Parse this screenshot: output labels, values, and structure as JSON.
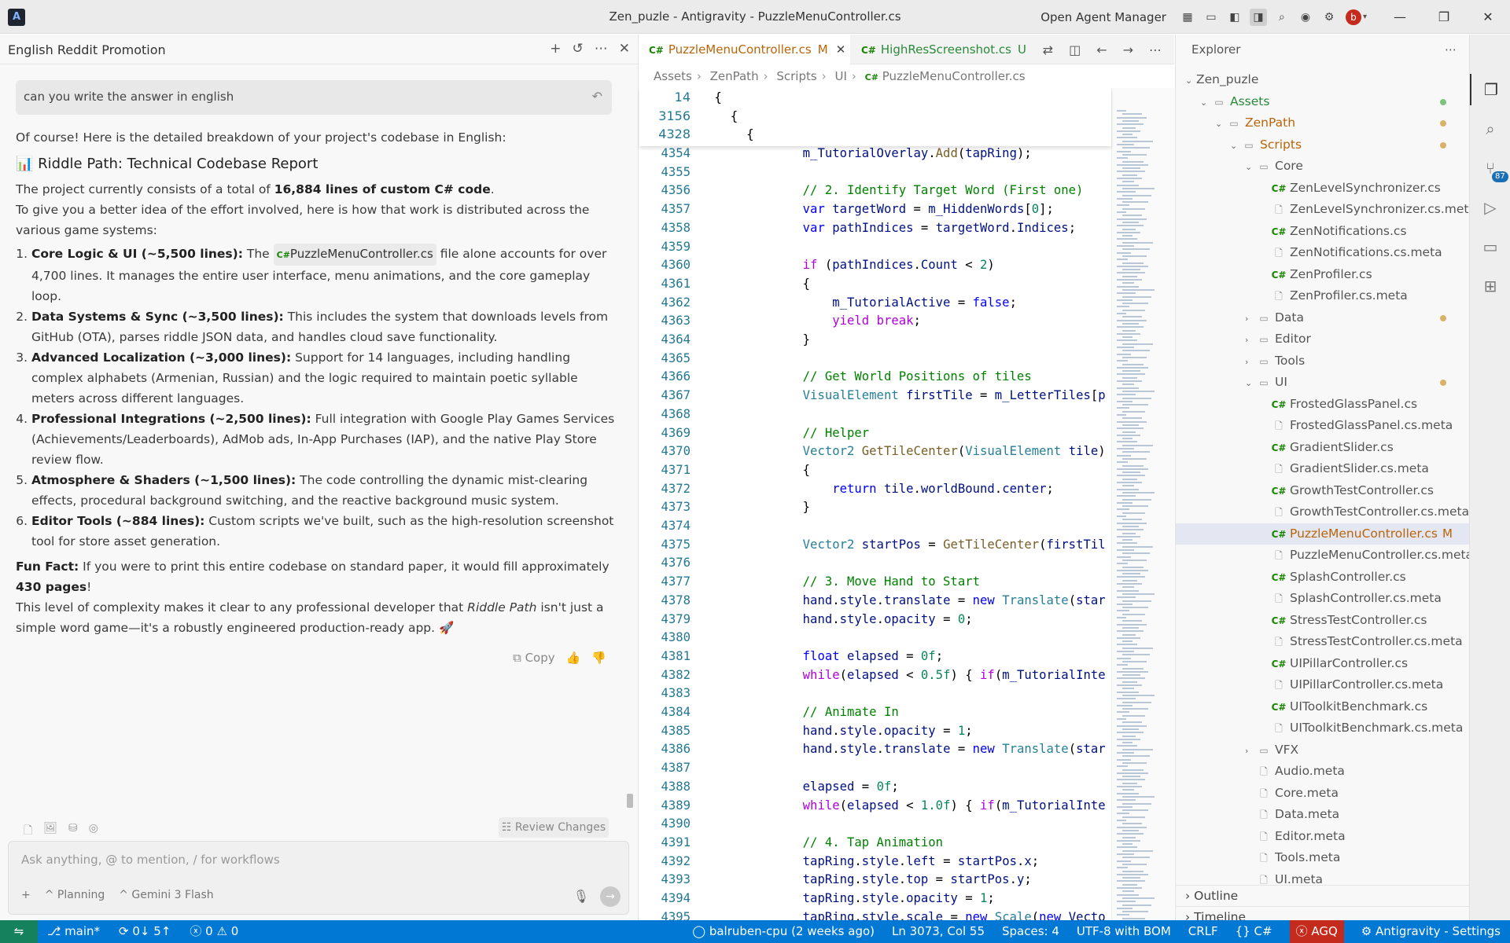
{
  "window": {
    "title": "Zen_puzle - Antigravity - PuzzleMenuController.cs",
    "open_agent_manager": "Open Agent Manager",
    "avatar_letter": "b"
  },
  "chat": {
    "title": "English Reddit Promotion",
    "user_message": "can you write the answer in english",
    "intro": "Of course! Here is the detailed breakdown of your project's codebase in English:",
    "heading_icon": "📊",
    "heading": "Riddle Path: Technical Codebase Report",
    "para1_prefix": "The project currently consists of a total of ",
    "para1_bold": "16,884 lines of custom C# code",
    "para1_suffix": ".",
    "para2": "To give you a better idea of the effort involved, here is how that work is distributed across the various game systems:",
    "items": [
      {
        "title": "Core Logic & UI (~5,500 lines):",
        "pre": " The ",
        "chip": "PuzzleMenuController.cs",
        "text": " file alone accounts for over 4,700 lines. It manages the entire user interface, menu animations, and the core gameplay loop."
      },
      {
        "title": "Data Systems & Sync (~3,500 lines):",
        "text": " This includes the system that downloads levels from GitHub (OTA), parses riddle JSON data, and handles cloud save functionality."
      },
      {
        "title": "Advanced Localization (~3,000 lines):",
        "text": " Support for 14 languages, including handling complex alphabets (Armenian, Russian) and the logic required to maintain poetic syllable meters across different languages."
      },
      {
        "title": "Professional Integrations (~2,500 lines):",
        "text": " Full integration with Google Play Games Services (Achievements/Leaderboards), AdMob ads, In-App Purchases (IAP), and the native Play Store review flow."
      },
      {
        "title": "Atmosphere & Shaders (~1,500 lines):",
        "text": " The code controlling the dynamic mist-clearing effects, procedural background switching, and the reactive background music system."
      },
      {
        "title": "Editor Tools (~884 lines):",
        "text": " Custom scripts we've built, such as the high-resolution screenshot tool for store asset generation."
      }
    ],
    "fun_label": "Fun Fact:",
    "fun_text": " If you were to print this entire codebase on standard paper, it would fill approximately ",
    "fun_bold": "430 pages",
    "fun_end": "!",
    "closing_pre": "This level of complexity makes it clear to any professional developer that ",
    "closing_em": "Riddle Path",
    "closing_post": " isn't just a simple word game—it's a robustly engineered production-ready app. 🚀",
    "copy_label": "Copy",
    "review_label": "Review Changes",
    "input_placeholder": "Ask anything, @ to mention, / for workflows",
    "mode_label": "Planning",
    "model_label": "Gemini 3 Flash"
  },
  "editor": {
    "tabs": [
      {
        "label": "PuzzleMenuController.cs",
        "mark": "M"
      },
      {
        "label": "HighResScreenshot.cs",
        "mark": "U"
      }
    ],
    "breadcrumbs": [
      "Assets",
      "ZenPath",
      "Scripts",
      "UI",
      "PuzzleMenuController.cs"
    ],
    "sticky": [
      {
        "ln": "14",
        "code": "{"
      },
      {
        "ln": "3156",
        "code": "    {"
      },
      {
        "ln": "4328",
        "code": "        {"
      }
    ],
    "lines": [
      {
        "ln": "4354",
        "code": "            m_TutorialOverlay.Add(tapRing);"
      },
      {
        "ln": "4355",
        "code": ""
      },
      {
        "ln": "4356",
        "code": "            // 2. Identify Target Word (First one)"
      },
      {
        "ln": "4357",
        "code": "            var targetWord = m_HiddenWords[0];"
      },
      {
        "ln": "4358",
        "code": "            var pathIndices = targetWord.Indices;"
      },
      {
        "ln": "4359",
        "code": ""
      },
      {
        "ln": "4360",
        "code": "            if (pathIndices.Count < 2)"
      },
      {
        "ln": "4361",
        "code": "            {"
      },
      {
        "ln": "4362",
        "code": "                m_TutorialActive = false;"
      },
      {
        "ln": "4363",
        "code": "                yield break;"
      },
      {
        "ln": "4364",
        "code": "            }"
      },
      {
        "ln": "4365",
        "code": ""
      },
      {
        "ln": "4366",
        "code": "            // Get World Positions of tiles"
      },
      {
        "ln": "4367",
        "code": "            VisualElement firstTile = m_LetterTiles[p"
      },
      {
        "ln": "4368",
        "code": ""
      },
      {
        "ln": "4369",
        "code": "            // Helper"
      },
      {
        "ln": "4370",
        "code": "            Vector2 GetTileCenter(VisualElement tile)"
      },
      {
        "ln": "4371",
        "code": "            {"
      },
      {
        "ln": "4372",
        "code": "                return tile.worldBound.center;"
      },
      {
        "ln": "4373",
        "code": "            }"
      },
      {
        "ln": "4374",
        "code": ""
      },
      {
        "ln": "4375",
        "code": "            Vector2 startPos = GetTileCenter(firstTil"
      },
      {
        "ln": "4376",
        "code": ""
      },
      {
        "ln": "4377",
        "code": "            // 3. Move Hand to Start"
      },
      {
        "ln": "4378",
        "code": "            hand.style.translate = new Translate(star"
      },
      {
        "ln": "4379",
        "code": "            hand.style.opacity = 0;"
      },
      {
        "ln": "4380",
        "code": ""
      },
      {
        "ln": "4381",
        "code": "            float elapsed = 0f;"
      },
      {
        "ln": "4382",
        "code": "            while(elapsed < 0.5f) { if(m_TutorialInte"
      },
      {
        "ln": "4383",
        "code": ""
      },
      {
        "ln": "4384",
        "code": "            // Animate In"
      },
      {
        "ln": "4385",
        "code": "            hand.style.opacity = 1;"
      },
      {
        "ln": "4386",
        "code": "            hand.style.translate = new Translate(star"
      },
      {
        "ln": "4387",
        "code": ""
      },
      {
        "ln": "4388",
        "code": "            elapsed = 0f;"
      },
      {
        "ln": "4389",
        "code": "            while(elapsed < 1.0f) { if(m_TutorialInte"
      },
      {
        "ln": "4390",
        "code": ""
      },
      {
        "ln": "4391",
        "code": "            // 4. Tap Animation"
      },
      {
        "ln": "4392",
        "code": "            tapRing.style.left = startPos.x;"
      },
      {
        "ln": "4393",
        "code": "            tapRing.style.top = startPos.y;"
      },
      {
        "ln": "4394",
        "code": "            tapRing.style.opacity = 1;"
      },
      {
        "ln": "4395",
        "code": "            tapRing.style.scale = new Scale(new Vecto"
      }
    ]
  },
  "explorer": {
    "title": "Explorer",
    "tree": [
      {
        "label": "Zen_puzle",
        "depth": 0,
        "kind": "root"
      },
      {
        "label": "Assets",
        "depth": 1,
        "kind": "folder-open",
        "color": "green",
        "dot": "green"
      },
      {
        "label": "ZenPath",
        "depth": 2,
        "kind": "folder-open",
        "color": "gold",
        "dot": "gold"
      },
      {
        "label": "Scripts",
        "depth": 3,
        "kind": "folder-open",
        "color": "gold",
        "dot": "gold"
      },
      {
        "label": "Core",
        "depth": 4,
        "kind": "folder-open"
      },
      {
        "label": "ZenLevelSynchronizer.cs",
        "depth": 5,
        "kind": "cs"
      },
      {
        "label": "ZenLevelSynchronizer.cs.meta",
        "depth": 5,
        "kind": "file"
      },
      {
        "label": "ZenNotifications.cs",
        "depth": 5,
        "kind": "cs"
      },
      {
        "label": "ZenNotifications.cs.meta",
        "depth": 5,
        "kind": "file"
      },
      {
        "label": "ZenProfiler.cs",
        "depth": 5,
        "kind": "cs"
      },
      {
        "label": "ZenProfiler.cs.meta",
        "depth": 5,
        "kind": "file"
      },
      {
        "label": "Data",
        "depth": 4,
        "kind": "folder",
        "dot": "gold"
      },
      {
        "label": "Editor",
        "depth": 4,
        "kind": "folder"
      },
      {
        "label": "Tools",
        "depth": 4,
        "kind": "folder"
      },
      {
        "label": "UI",
        "depth": 4,
        "kind": "folder-open",
        "dot": "gold"
      },
      {
        "label": "FrostedGlassPanel.cs",
        "depth": 5,
        "kind": "cs"
      },
      {
        "label": "FrostedGlassPanel.cs.meta",
        "depth": 5,
        "kind": "file"
      },
      {
        "label": "GradientSlider.cs",
        "depth": 5,
        "kind": "cs"
      },
      {
        "label": "GradientSlider.cs.meta",
        "depth": 5,
        "kind": "file"
      },
      {
        "label": "GrowthTestController.cs",
        "depth": 5,
        "kind": "cs"
      },
      {
        "label": "GrowthTestController.cs.meta",
        "depth": 5,
        "kind": "file"
      },
      {
        "label": "PuzzleMenuController.cs",
        "depth": 5,
        "kind": "cs",
        "selected": true,
        "mark": "M",
        "color": "gold"
      },
      {
        "label": "PuzzleMenuController.cs.meta",
        "depth": 5,
        "kind": "file"
      },
      {
        "label": "SplashController.cs",
        "depth": 5,
        "kind": "cs"
      },
      {
        "label": "SplashController.cs.meta",
        "depth": 5,
        "kind": "file"
      },
      {
        "label": "StressTestController.cs",
        "depth": 5,
        "kind": "cs"
      },
      {
        "label": "StressTestController.cs.meta",
        "depth": 5,
        "kind": "file"
      },
      {
        "label": "UIPillarController.cs",
        "depth": 5,
        "kind": "cs"
      },
      {
        "label": "UIPillarController.cs.meta",
        "depth": 5,
        "kind": "file"
      },
      {
        "label": "UIToolkitBenchmark.cs",
        "depth": 5,
        "kind": "cs"
      },
      {
        "label": "UIToolkitBenchmark.cs.meta",
        "depth": 5,
        "kind": "file"
      },
      {
        "label": "VFX",
        "depth": 4,
        "kind": "folder"
      },
      {
        "label": "Audio.meta",
        "depth": 4,
        "kind": "file"
      },
      {
        "label": "Core.meta",
        "depth": 4,
        "kind": "file"
      },
      {
        "label": "Data.meta",
        "depth": 4,
        "kind": "file"
      },
      {
        "label": "Editor.meta",
        "depth": 4,
        "kind": "file"
      },
      {
        "label": "Tools.meta",
        "depth": 4,
        "kind": "file"
      },
      {
        "label": "UI.meta",
        "depth": 4,
        "kind": "file"
      }
    ],
    "outline": "Outline",
    "timeline": "Timeline"
  },
  "activity": {
    "scm_badge": "87"
  },
  "status": {
    "branch": "main*",
    "sync": "0↓ 5↑",
    "errors": "0",
    "warnings": "0",
    "blame": "balruben-cpu (2 weeks ago)",
    "position": "Ln 3073, Col 55",
    "spaces": "Spaces: 4",
    "encoding": "UTF-8 with BOM",
    "eol": "CRLF",
    "language": "C#",
    "agq": "AGQ",
    "settings": "Antigravity - Settings"
  },
  "colors": {
    "accent": "#0078d4",
    "modified": "#b8650a",
    "untracked": "#2a8a3a",
    "csharp": "#178600"
  }
}
